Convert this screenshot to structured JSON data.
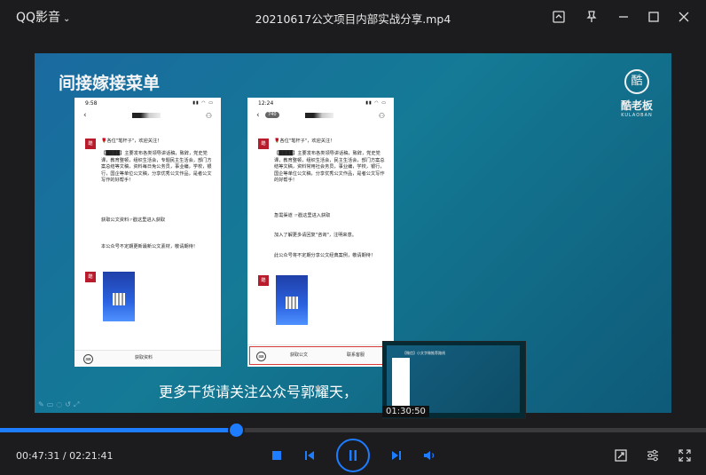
{
  "app": {
    "name": "QQ影音",
    "file_title": "20210617公文项目内部实战分享.mp4"
  },
  "slide": {
    "heading": "间接嫁接菜单",
    "logo_text": "酷老板",
    "logo_en": "KULAOBAN",
    "logo_glyph": "酷"
  },
  "phone_left": {
    "time": "9:58",
    "greeting": "🌹各位\"笔杆子\"，欢迎关注！",
    "body": "【████】主要发布各类领导讲话稿，致辞，党史党课，教育整顿，组织生活会，专题民主生活会，部门方案总结等文稿，资料每日免公务员，事业编，学校，银行，国企等单位公文稿，分享优秀公文作品，是者公文写作的好帮手！",
    "link": "获取公文资料☞戳这里进入获取",
    "note": "本公众号不定期更新最新公文素材，敬请期待！",
    "bottom_label": "获取资料"
  },
  "phone_right": {
    "time": "12:24",
    "badge": "740",
    "greeting": "🌹各位\"笔杆子\"，欢迎关注！",
    "body": "【████】主要发布各类领导讲话稿，致辞，党史党课，教育整顿，组织生活会，民主生活会，部门方案总结等文稿，资料常用社会务员，事业编，学校，银行，国企等单位公文稿，分享优秀公文作品，是者公文写作的好帮手！",
    "link": "急需渠道 ☞戳这里进入获取",
    "note1": "加入了解更多请回复\"咨询\"，注明来意。",
    "note2": "此公众号将不定期分享公文经典案例，敬请期待！",
    "bottom_label_1": "获取公文",
    "bottom_label_2": "联系客服"
  },
  "subtitle": "更多干货请关注公众号郭耀天，",
  "preview": {
    "time": "01:30:50",
    "caption": "【微信】小文字做推荐路线"
  },
  "playback": {
    "current": "00:47:31",
    "total": "02:21:41",
    "timecode": "00:47:31 / 02:21:41",
    "progress": 0.335,
    "accent_color": "#1e7cff"
  },
  "icons": {
    "title_chevron": "chevron-down-icon",
    "screenshot": "screenshot-icon",
    "pin": "pin-icon",
    "minimize": "minimize-icon",
    "maximize": "maximize-icon",
    "close": "close-icon",
    "stop": "stop-icon",
    "prev": "previous-icon",
    "play_pause": "pause-icon",
    "next": "next-icon",
    "volume": "volume-icon",
    "screenshot_tool": "crop-icon",
    "settings": "settings-sliders-icon",
    "fullscreen": "fullscreen-icon"
  }
}
